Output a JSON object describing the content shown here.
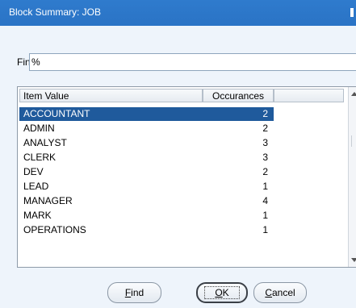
{
  "window": {
    "title": "Block Summary: JOB"
  },
  "find": {
    "label": "Find",
    "value": "%"
  },
  "table": {
    "columns": [
      "Item Value",
      "Occurances"
    ],
    "rows": [
      {
        "value": "ACCOUNTANT",
        "count": "2",
        "selected": true
      },
      {
        "value": "ADMIN",
        "count": "2"
      },
      {
        "value": "ANALYST",
        "count": "3"
      },
      {
        "value": "CLERK",
        "count": "3"
      },
      {
        "value": "DEV",
        "count": "2"
      },
      {
        "value": "LEAD",
        "count": "1"
      },
      {
        "value": "MANAGER",
        "count": "4"
      },
      {
        "value": "MARK",
        "count": "1"
      },
      {
        "value": "OPERATIONS",
        "count": "1"
      }
    ]
  },
  "buttons": {
    "find": {
      "mnemonic": "F",
      "rest": "ind"
    },
    "ok": {
      "mnemonic": "O",
      "rest": "K"
    },
    "cancel": {
      "mnemonic": "C",
      "rest": "ancel"
    }
  },
  "colors": {
    "titlebar": "#2a73c5",
    "selection": "#1f5a9c",
    "background": "#eef4fb"
  }
}
